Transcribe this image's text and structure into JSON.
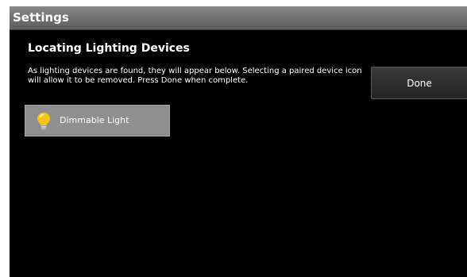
{
  "titlebar": {
    "title": "Settings"
  },
  "main": {
    "heading": "Locating Lighting Devices",
    "instructions": "As lighting devices are found, they will appear below.  Selecting a paired device icon will allow it to be removed.  Press Done when complete.",
    "done_label": "Done"
  },
  "devices": [
    {
      "label": "Dimmable Light",
      "icon": "light-bulb-icon"
    }
  ],
  "colors": {
    "bulb": "#f5c518",
    "tile": "#8f8f8f",
    "background": "#000000"
  }
}
